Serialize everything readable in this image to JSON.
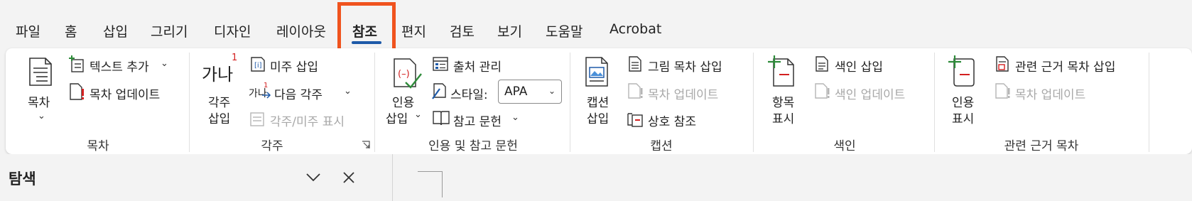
{
  "tabs": [
    {
      "label": "파일"
    },
    {
      "label": "홈"
    },
    {
      "label": "삽입"
    },
    {
      "label": "그리기"
    },
    {
      "label": "디자인"
    },
    {
      "label": "레이아웃"
    },
    {
      "label": "참조"
    },
    {
      "label": "편지"
    },
    {
      "label": "검토"
    },
    {
      "label": "보기"
    },
    {
      "label": "도움말"
    },
    {
      "label": "Acrobat"
    }
  ],
  "active_tab": "참조",
  "colors": {
    "accent": "#1e5aa8",
    "highlight": "#f0531e",
    "ribbon_bg": "#ffffff",
    "app_bg": "#f3f3f3"
  },
  "toc": {
    "big_button": "목차",
    "add_text": "텍스트 추가",
    "update": "목차 업데이트",
    "group": "목차"
  },
  "footnotes": {
    "insert_line1": "각주",
    "insert_line2": "삽입",
    "big_icon_text": "가나",
    "big_icon_sup": "1",
    "insert_endnote": "미주 삽입",
    "next_footnote": "다음 각주",
    "next_icon_text": "가나",
    "show_notes": "각주/미주 표시",
    "group": "각주"
  },
  "citations": {
    "insert_line1": "인용",
    "insert_line2": "삽입",
    "manage_sources": "출처 관리",
    "style_label": "스타일:",
    "style_value": "APA",
    "bibliography": "참고 문헌",
    "group": "인용 및 참고 문헌"
  },
  "captions": {
    "insert_line1": "캡션",
    "insert_line2": "삽입",
    "insert_tof": "그림 목차 삽입",
    "update_table": "목차 업데이트",
    "cross_ref": "상호 참조",
    "group": "캡션"
  },
  "index": {
    "mark_line1": "항목",
    "mark_line2": "표시",
    "insert_index": "색인 삽입",
    "update_index": "색인 업데이트",
    "group": "색인"
  },
  "authorities": {
    "mark_line1": "인용",
    "mark_line2": "표시",
    "insert_toa": "관련 근거 목차 삽입",
    "update_toa": "목차 업데이트",
    "group": "관련 근거 목차"
  },
  "navigation": {
    "title": "탐색"
  }
}
